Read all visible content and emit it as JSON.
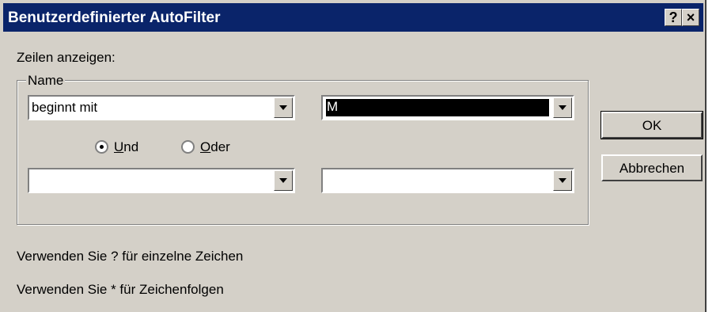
{
  "window": {
    "title": "Benutzerdefinierter AutoFilter",
    "help_label": "?",
    "close_label": "×"
  },
  "main": {
    "prompt": "Zeilen anzeigen:",
    "group_label": "Name",
    "criteria1": {
      "operator": "beginnt mit",
      "value": "M"
    },
    "logic": {
      "and": {
        "label_first": "U",
        "label_rest": "nd",
        "selected": true
      },
      "or": {
        "label_first": "O",
        "label_rest": "der",
        "selected": false
      }
    },
    "criteria2": {
      "operator": "",
      "value": ""
    },
    "hint1": "Verwenden Sie ? für einzelne Zeichen",
    "hint2": "Verwenden Sie * für Zeichenfolgen"
  },
  "buttons": {
    "ok": "OK",
    "cancel": "Abbrechen"
  }
}
